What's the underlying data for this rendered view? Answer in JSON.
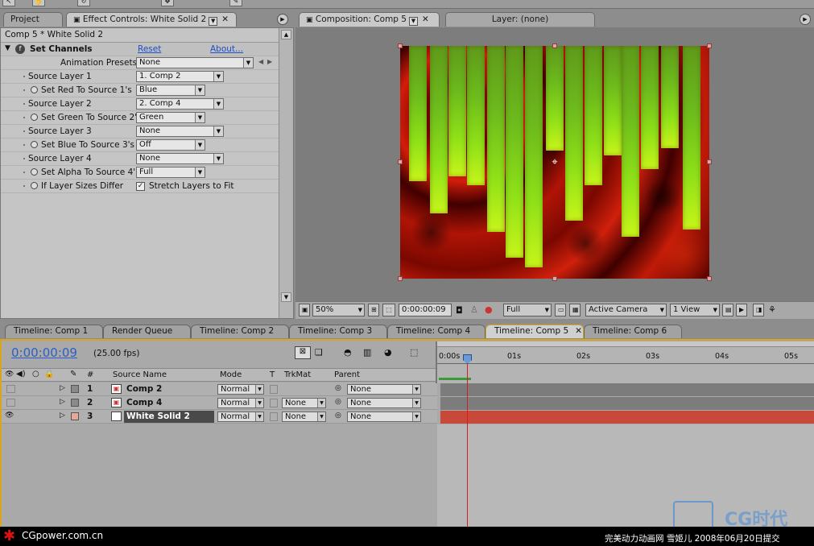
{
  "project_tab": "Project",
  "effect_tab": "Effect Controls: White Solid 2",
  "comp_tab": "Composition: Comp 5",
  "layer_tab": "Layer: (none)",
  "effect_header": "Comp 5 * White Solid 2",
  "effect": {
    "name": "Set Channels",
    "reset": "Reset",
    "about": "About...",
    "anim_presets_label": "Animation Presets:",
    "anim_presets_value": "None",
    "rows": [
      {
        "label": "Source Layer 1",
        "value": "1. Comp 2"
      },
      {
        "label": "Set Red To Source 1's",
        "value": "Blue"
      },
      {
        "label": "Source Layer 2",
        "value": "2. Comp 4"
      },
      {
        "label": "Set Green To Source 2'",
        "value": "Green"
      },
      {
        "label": "Source Layer 3",
        "value": "None"
      },
      {
        "label": "Set Blue To Source 3's",
        "value": "Off"
      },
      {
        "label": "Source Layer 4",
        "value": "None"
      },
      {
        "label": "Set Alpha To Source 4'",
        "value": "Full"
      },
      {
        "label": "If Layer Sizes Differ",
        "value": "Stretch Layers to Fit"
      }
    ]
  },
  "comp_toolbar": {
    "zoom": "50%",
    "timecode": "0:00:00:09",
    "resolution": "Full",
    "camera": "Active Camera",
    "view": "1 View"
  },
  "timeline_tabs": [
    "Timeline: Comp 1",
    "Render Queue",
    "Timeline: Comp 2",
    "Timeline: Comp 3",
    "Timeline: Comp 4",
    "Timeline: Comp 5",
    "Timeline: Comp 6"
  ],
  "timeline": {
    "timecode": "0:00:00:09",
    "fps": "(25.00 fps)",
    "columns": {
      "num": "#",
      "source": "Source Name",
      "mode": "Mode",
      "t": "T",
      "trkmat": "TrkMat",
      "parent": "Parent"
    },
    "ruler": [
      "0:00s",
      "01s",
      "02s",
      "03s",
      "04s",
      "05s"
    ],
    "layers": [
      {
        "num": "1",
        "name": "Comp 2",
        "mode": "Normal",
        "trkmat": "",
        "parent": "None",
        "color": "#8a8a8a"
      },
      {
        "num": "2",
        "name": "Comp 4",
        "mode": "Normal",
        "trkmat": "None",
        "parent": "None",
        "color": "#8a8a8a"
      },
      {
        "num": "3",
        "name": "White Solid 2",
        "mode": "Normal",
        "trkmat": "None",
        "parent": "None",
        "color": "#e8a898"
      }
    ]
  },
  "watermark": {
    "left": "CGpower.com.cn",
    "right": "完美动力动画网 雪姬儿 2008年06月20日提交",
    "logo": "CG时代"
  },
  "colors": {
    "timecode": "#2a5fc8",
    "playhead": "#d02020",
    "selected_track": "#c8483a"
  },
  "bar_levels": [
    0.58,
    0.72,
    0.56,
    0.6,
    0.8,
    0.91,
    0.95,
    0.45,
    0.75,
    0.6,
    0.47,
    0.82,
    0.53,
    0.44,
    0.79
  ]
}
